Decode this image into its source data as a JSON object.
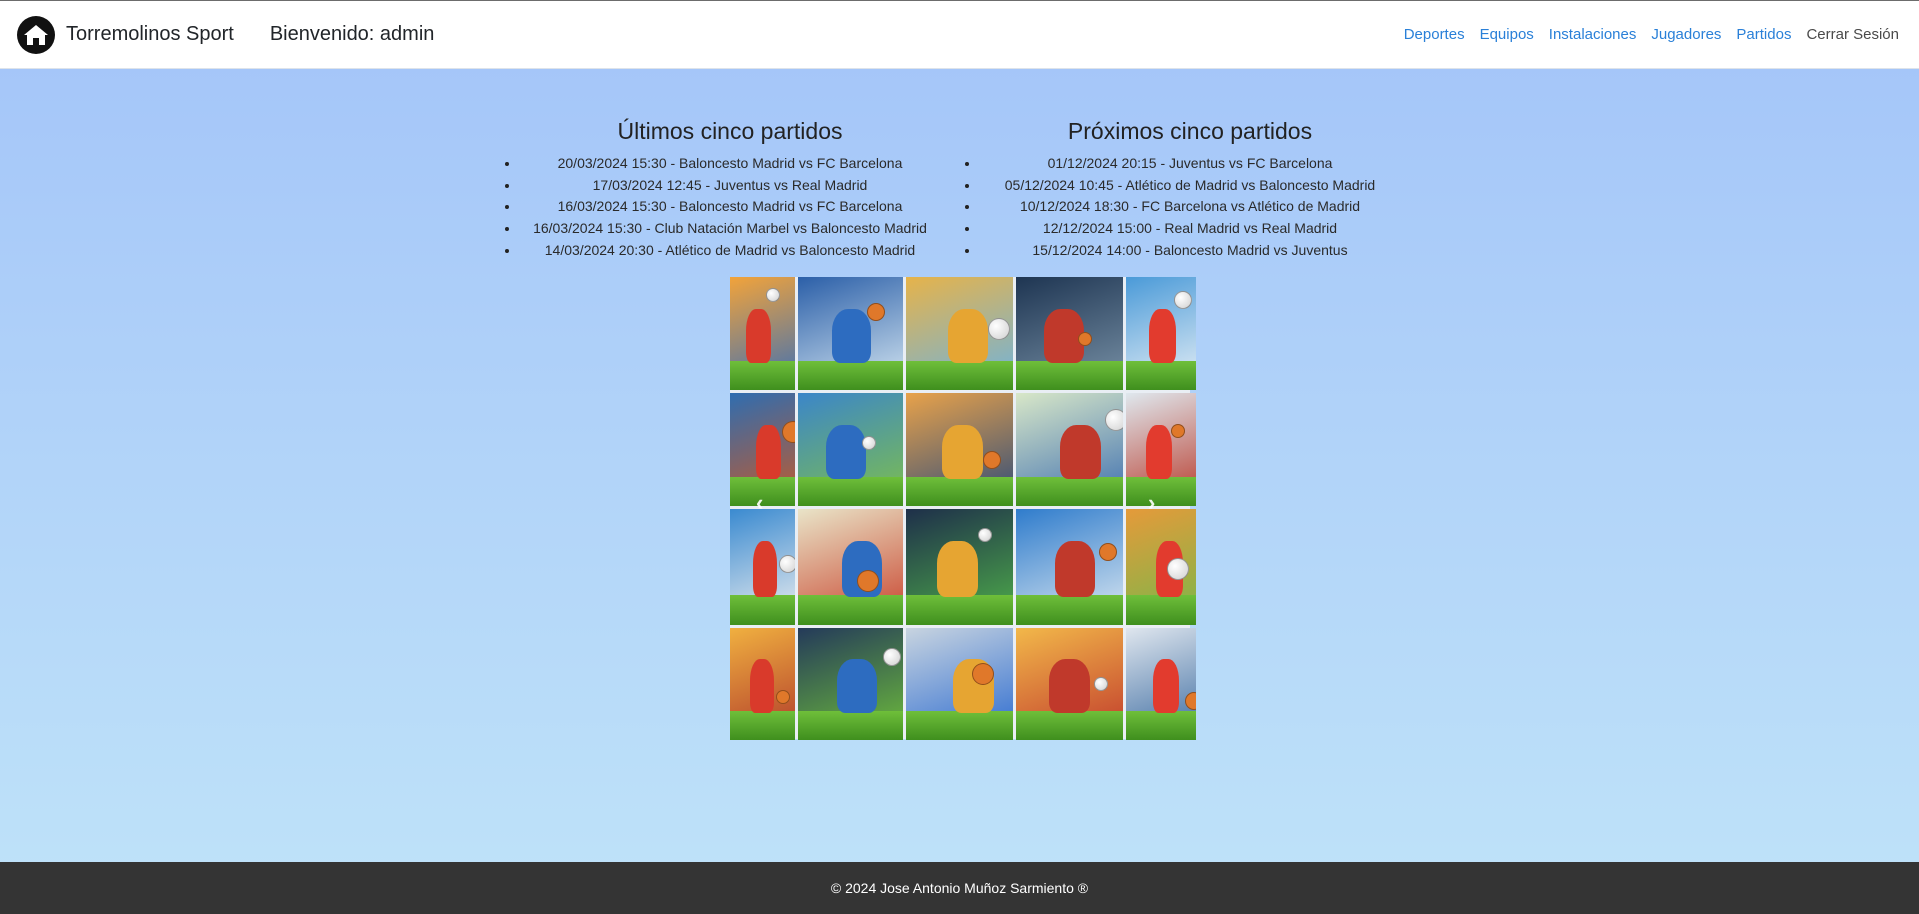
{
  "header": {
    "brand": "Torremolinos Sport",
    "welcome": "Bienvenido: admin",
    "nav": [
      {
        "label": "Deportes"
      },
      {
        "label": "Equipos"
      },
      {
        "label": "Instalaciones"
      },
      {
        "label": "Jugadores"
      },
      {
        "label": "Partidos"
      }
    ],
    "logout": "Cerrar Sesión",
    "logo_icon": "house-icon"
  },
  "last_matches": {
    "title": "Últimos cinco partidos",
    "items": [
      "20/03/2024 15:30 - Baloncesto Madrid vs FC Barcelona",
      "17/03/2024 12:45 - Juventus vs Real Madrid",
      "16/03/2024 15:30 - Baloncesto Madrid vs FC Barcelona",
      "16/03/2024 15:30 - Club Natación Marbel vs Baloncesto Madrid",
      "14/03/2024 20:30 - Atlético de Madrid vs Baloncesto Madrid"
    ]
  },
  "next_matches": {
    "title": "Próximos cinco partidos",
    "items": [
      "01/12/2024 20:15 - Juventus vs FC Barcelona",
      "05/12/2024 10:45 - Atlético de Madrid vs Baloncesto Madrid",
      "10/12/2024 18:30 - FC Barcelona vs Atlético de Madrid",
      "12/12/2024 15:00 - Real Madrid vs Real Madrid",
      "15/12/2024 14:00 - Baloncesto Madrid vs Juventus"
    ]
  },
  "carousel": {
    "prev_icon": "chevron-left-icon",
    "next_icon": "chevron-right-icon",
    "prev_glyph": "‹",
    "next_glyph": "›"
  },
  "footer": {
    "text": "© 2024 Jose Antonio Muñoz Sarmiento ®"
  },
  "colors": {
    "link": "#2a80d8",
    "footer_bg": "#343434",
    "bg_top": "#a3c4f9",
    "bg_bottom": "#bfe3f9"
  }
}
